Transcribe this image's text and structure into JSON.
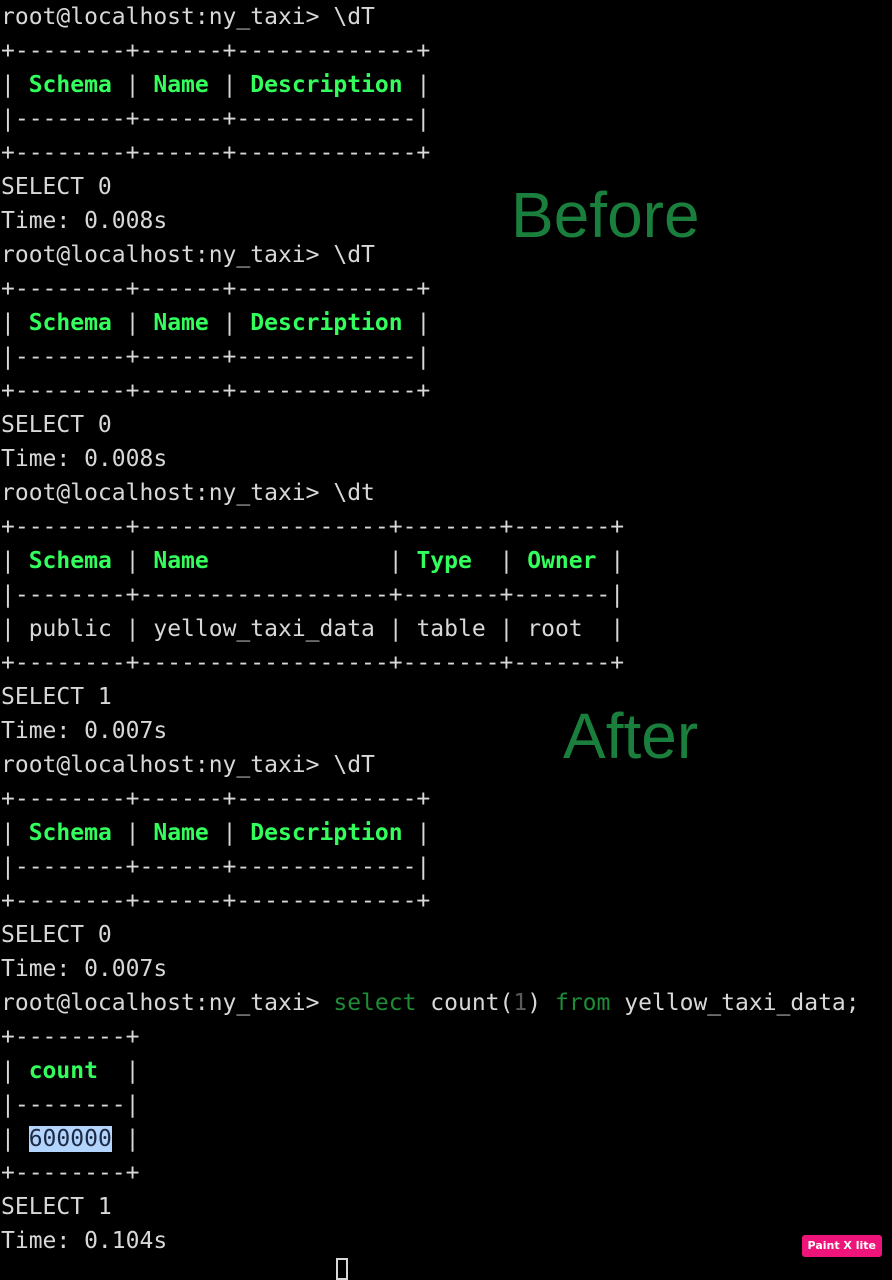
{
  "prompt": "root@localhost:ny_taxi> ",
  "blocks": {
    "b1": {
      "command": "\\dT",
      "border": "+--------+------+-------------+",
      "sep": "|--------+------+-------------|",
      "h_schema": "Schema",
      "h_name": "Name",
      "h_description": "Description",
      "result": "SELECT 0",
      "time": "Time: 0.008s"
    },
    "b2": {
      "command": "\\dT",
      "border": "+--------+------+-------------+",
      "sep": "|--------+------+-------------|",
      "h_schema": "Schema",
      "h_name": "Name",
      "h_description": "Description",
      "result": "SELECT 0",
      "time": "Time: 0.008s"
    },
    "b3": {
      "command": "\\dt",
      "border": "+--------+------------------+-------+-------+",
      "sep": "|--------+------------------+-------+-------|",
      "h_schema": "Schema",
      "h_name": "Name",
      "h_type": "Type",
      "h_owner": "Owner",
      "row_schema": "public",
      "row_name": "yellow_taxi_data",
      "row_type": "table",
      "row_owner": "root",
      "result": "SELECT 1",
      "time": "Time: 0.007s"
    },
    "b4": {
      "command": "\\dT",
      "border": "+--------+------+-------------+",
      "sep": "|--------+------+-------------|",
      "h_schema": "Schema",
      "h_name": "Name",
      "h_description": "Description",
      "result": "SELECT 0",
      "time": "Time: 0.007s"
    },
    "b5": {
      "cmd_kw1": "select",
      "cmd_fn": "count(",
      "cmd_arg": "1",
      "cmd_close": ")",
      "cmd_kw2": "from",
      "cmd_table": "yellow_taxi_data;",
      "border": "+--------+",
      "sep": "|--------|",
      "h_count": "count",
      "row_count": "600000",
      "result": "SELECT 1",
      "time": "Time: 0.104s"
    }
  },
  "annotations": {
    "before": "Before",
    "after": "After"
  },
  "watermark": "Paint X lite",
  "colors": {
    "background": "#000000",
    "text": "#d8d8d8",
    "header": "#33ff5c",
    "keyword": "#1e8c36",
    "annotation": "#1a7f3c",
    "selection": "#b3d4fc",
    "watermark": "#ee1479"
  }
}
